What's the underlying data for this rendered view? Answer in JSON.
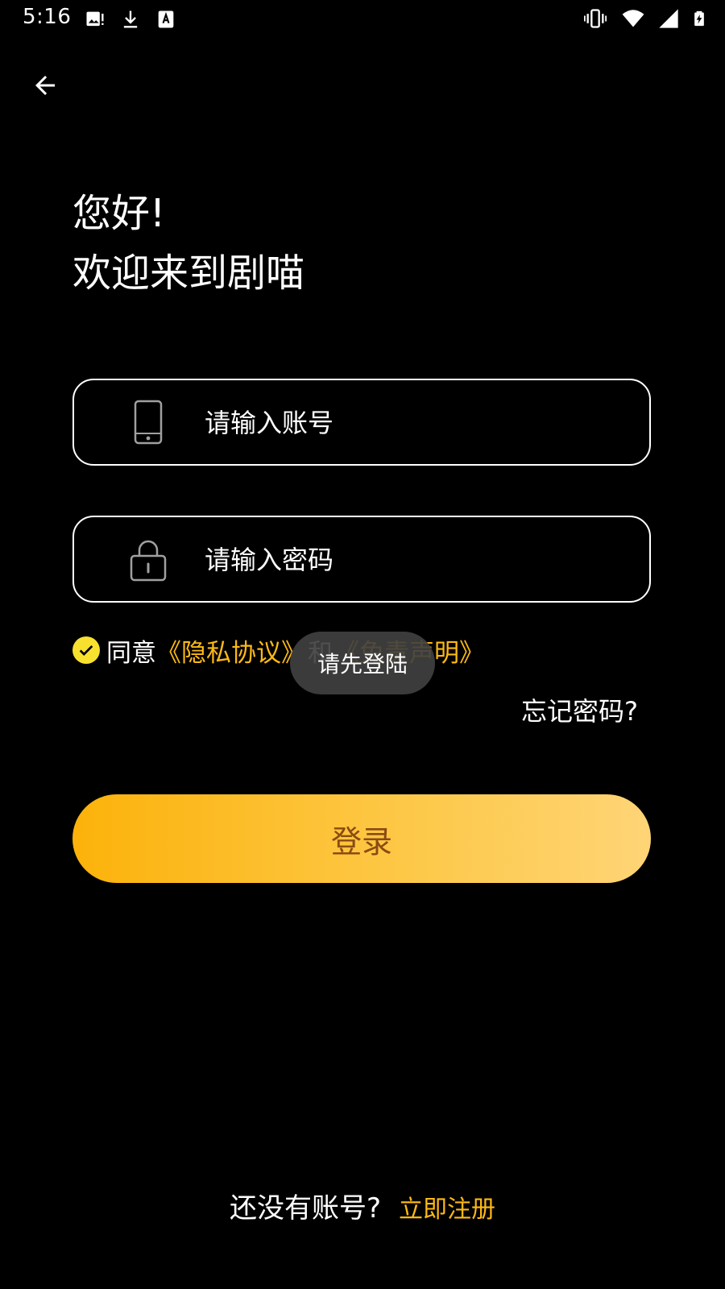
{
  "status_bar": {
    "time": "5:16",
    "left_icons": [
      "image-icon",
      "download-icon",
      "font-icon"
    ],
    "right_icons": [
      "vibrate-icon",
      "wifi-icon",
      "signal-icon",
      "battery-charging-icon"
    ]
  },
  "header": {
    "back_icon": "arrow-left-icon"
  },
  "greeting": {
    "line1": "您好!",
    "line2": "欢迎来到剧喵"
  },
  "form": {
    "account_placeholder": "请输入账号",
    "account_icon": "phone-icon",
    "password_placeholder": "请输入密码",
    "password_icon": "lock-icon"
  },
  "agreement": {
    "checked": true,
    "prefix": "同意",
    "privacy_link": "《隐私协议》",
    "and": "和",
    "disclaimer_link": "《免责声明》"
  },
  "toast": {
    "message": "请先登陆"
  },
  "forgot_password": "忘记密码?",
  "login_button": "登录",
  "register": {
    "question": "还没有账号?",
    "link": "立即注册"
  },
  "colors": {
    "background": "#000000",
    "accent": "#fdb915",
    "check": "#f8e12e",
    "button_gradient_start": "#fcb20a",
    "button_gradient_end": "#fed476",
    "button_text": "#8a4b12"
  }
}
